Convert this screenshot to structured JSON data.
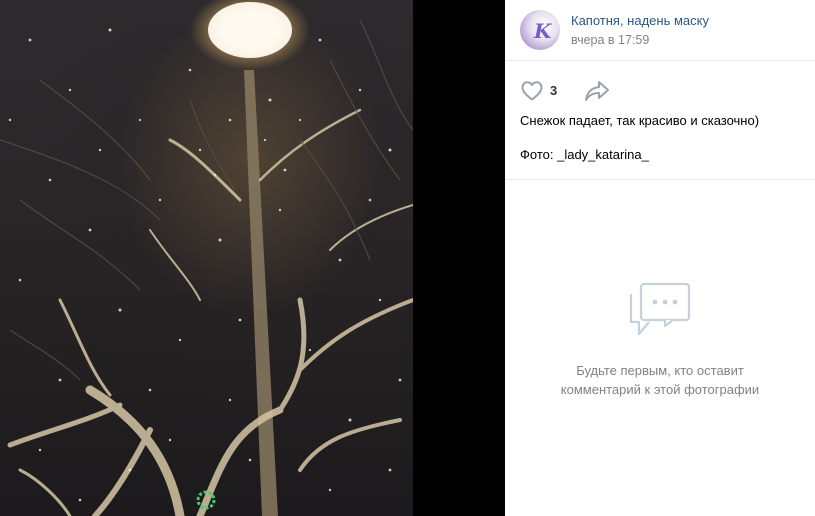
{
  "post": {
    "author": "Капотня, надень маску",
    "date": "вчера в 17:59",
    "likes": "3",
    "caption": "Снежок падает, так красиво и сказочно)",
    "credit": "Фото: _lady_katarina_"
  },
  "comments": {
    "empty_line1": "Будьте первым, кто оставит",
    "empty_line2": "комментарий к этой фотографии"
  },
  "icons": {
    "like": "heart-outline-icon",
    "share": "share-arrow-icon",
    "empty": "comments-bubble-icon"
  },
  "colors": {
    "author_link": "#2a5885",
    "muted": "#828282",
    "icon": "#99a2ad",
    "panel_bg": "#ffffff"
  }
}
